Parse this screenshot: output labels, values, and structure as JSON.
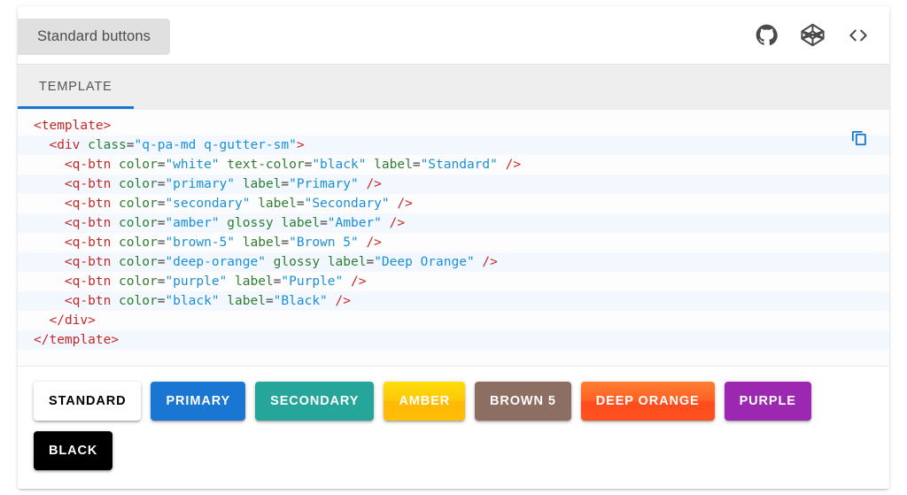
{
  "card": {
    "title_tag": "Standard buttons"
  },
  "header": {
    "icons": [
      {
        "name": "github-icon",
        "label": "GitHub"
      },
      {
        "name": "codepen-icon",
        "label": "Codepen"
      },
      {
        "name": "code-icon",
        "label": "Source code"
      }
    ],
    "icon_color": "#4a4a4a"
  },
  "tabs": [
    {
      "label": "TEMPLATE",
      "active": true
    }
  ],
  "code": {
    "language": "html",
    "copy_icon": "copy-icon",
    "copy_icon_color": "#1976d2",
    "colors": {
      "tag": "#c62828",
      "attribute": "#2e7d32",
      "value": "#1a8fd8",
      "background": "#fdfdfd",
      "stripe": "#f2f8fd"
    },
    "lines": [
      [
        {
          "t": "punc",
          "s": "<"
        },
        {
          "t": "tag",
          "s": "template"
        },
        {
          "t": "punc",
          "s": ">"
        }
      ],
      [
        {
          "t": "plain",
          "s": "  "
        },
        {
          "t": "punc",
          "s": "<"
        },
        {
          "t": "tag",
          "s": "div"
        },
        {
          "t": "plain",
          "s": " "
        },
        {
          "t": "attr",
          "s": "class"
        },
        {
          "t": "plain",
          "s": "="
        },
        {
          "t": "val",
          "s": "\"q-pa-md q-gutter-sm\""
        },
        {
          "t": "punc",
          "s": ">"
        }
      ],
      [
        {
          "t": "plain",
          "s": "    "
        },
        {
          "t": "punc",
          "s": "<"
        },
        {
          "t": "tag",
          "s": "q-btn"
        },
        {
          "t": "plain",
          "s": " "
        },
        {
          "t": "attr",
          "s": "color"
        },
        {
          "t": "plain",
          "s": "="
        },
        {
          "t": "val",
          "s": "\"white\""
        },
        {
          "t": "plain",
          "s": " "
        },
        {
          "t": "attr",
          "s": "text-color"
        },
        {
          "t": "plain",
          "s": "="
        },
        {
          "t": "val",
          "s": "\"black\""
        },
        {
          "t": "plain",
          "s": " "
        },
        {
          "t": "attr",
          "s": "label"
        },
        {
          "t": "plain",
          "s": "="
        },
        {
          "t": "val",
          "s": "\"Standard\""
        },
        {
          "t": "plain",
          "s": " "
        },
        {
          "t": "punc",
          "s": "/>"
        }
      ],
      [
        {
          "t": "plain",
          "s": "    "
        },
        {
          "t": "punc",
          "s": "<"
        },
        {
          "t": "tag",
          "s": "q-btn"
        },
        {
          "t": "plain",
          "s": " "
        },
        {
          "t": "attr",
          "s": "color"
        },
        {
          "t": "plain",
          "s": "="
        },
        {
          "t": "val",
          "s": "\"primary\""
        },
        {
          "t": "plain",
          "s": " "
        },
        {
          "t": "attr",
          "s": "label"
        },
        {
          "t": "plain",
          "s": "="
        },
        {
          "t": "val",
          "s": "\"Primary\""
        },
        {
          "t": "plain",
          "s": " "
        },
        {
          "t": "punc",
          "s": "/>"
        }
      ],
      [
        {
          "t": "plain",
          "s": "    "
        },
        {
          "t": "punc",
          "s": "<"
        },
        {
          "t": "tag",
          "s": "q-btn"
        },
        {
          "t": "plain",
          "s": " "
        },
        {
          "t": "attr",
          "s": "color"
        },
        {
          "t": "plain",
          "s": "="
        },
        {
          "t": "val",
          "s": "\"secondary\""
        },
        {
          "t": "plain",
          "s": " "
        },
        {
          "t": "attr",
          "s": "label"
        },
        {
          "t": "plain",
          "s": "="
        },
        {
          "t": "val",
          "s": "\"Secondary\""
        },
        {
          "t": "plain",
          "s": " "
        },
        {
          "t": "punc",
          "s": "/>"
        }
      ],
      [
        {
          "t": "plain",
          "s": "    "
        },
        {
          "t": "punc",
          "s": "<"
        },
        {
          "t": "tag",
          "s": "q-btn"
        },
        {
          "t": "plain",
          "s": " "
        },
        {
          "t": "attr",
          "s": "color"
        },
        {
          "t": "plain",
          "s": "="
        },
        {
          "t": "val",
          "s": "\"amber\""
        },
        {
          "t": "plain",
          "s": " "
        },
        {
          "t": "attr",
          "s": "glossy"
        },
        {
          "t": "plain",
          "s": " "
        },
        {
          "t": "attr",
          "s": "label"
        },
        {
          "t": "plain",
          "s": "="
        },
        {
          "t": "val",
          "s": "\"Amber\""
        },
        {
          "t": "plain",
          "s": " "
        },
        {
          "t": "punc",
          "s": "/>"
        }
      ],
      [
        {
          "t": "plain",
          "s": "    "
        },
        {
          "t": "punc",
          "s": "<"
        },
        {
          "t": "tag",
          "s": "q-btn"
        },
        {
          "t": "plain",
          "s": " "
        },
        {
          "t": "attr",
          "s": "color"
        },
        {
          "t": "plain",
          "s": "="
        },
        {
          "t": "val",
          "s": "\"brown-5\""
        },
        {
          "t": "plain",
          "s": " "
        },
        {
          "t": "attr",
          "s": "label"
        },
        {
          "t": "plain",
          "s": "="
        },
        {
          "t": "val",
          "s": "\"Brown 5\""
        },
        {
          "t": "plain",
          "s": " "
        },
        {
          "t": "punc",
          "s": "/>"
        }
      ],
      [
        {
          "t": "plain",
          "s": "    "
        },
        {
          "t": "punc",
          "s": "<"
        },
        {
          "t": "tag",
          "s": "q-btn"
        },
        {
          "t": "plain",
          "s": " "
        },
        {
          "t": "attr",
          "s": "color"
        },
        {
          "t": "plain",
          "s": "="
        },
        {
          "t": "val",
          "s": "\"deep-orange\""
        },
        {
          "t": "plain",
          "s": " "
        },
        {
          "t": "attr",
          "s": "glossy"
        },
        {
          "t": "plain",
          "s": " "
        },
        {
          "t": "attr",
          "s": "label"
        },
        {
          "t": "plain",
          "s": "="
        },
        {
          "t": "val",
          "s": "\"Deep Orange\""
        },
        {
          "t": "plain",
          "s": " "
        },
        {
          "t": "punc",
          "s": "/>"
        }
      ],
      [
        {
          "t": "plain",
          "s": "    "
        },
        {
          "t": "punc",
          "s": "<"
        },
        {
          "t": "tag",
          "s": "q-btn"
        },
        {
          "t": "plain",
          "s": " "
        },
        {
          "t": "attr",
          "s": "color"
        },
        {
          "t": "plain",
          "s": "="
        },
        {
          "t": "val",
          "s": "\"purple\""
        },
        {
          "t": "plain",
          "s": " "
        },
        {
          "t": "attr",
          "s": "label"
        },
        {
          "t": "plain",
          "s": "="
        },
        {
          "t": "val",
          "s": "\"Purple\""
        },
        {
          "t": "plain",
          "s": " "
        },
        {
          "t": "punc",
          "s": "/>"
        }
      ],
      [
        {
          "t": "plain",
          "s": "    "
        },
        {
          "t": "punc",
          "s": "<"
        },
        {
          "t": "tag",
          "s": "q-btn"
        },
        {
          "t": "plain",
          "s": " "
        },
        {
          "t": "attr",
          "s": "color"
        },
        {
          "t": "plain",
          "s": "="
        },
        {
          "t": "val",
          "s": "\"black\""
        },
        {
          "t": "plain",
          "s": " "
        },
        {
          "t": "attr",
          "s": "label"
        },
        {
          "t": "plain",
          "s": "="
        },
        {
          "t": "val",
          "s": "\"Black\""
        },
        {
          "t": "plain",
          "s": " "
        },
        {
          "t": "punc",
          "s": "/>"
        }
      ],
      [
        {
          "t": "plain",
          "s": "  "
        },
        {
          "t": "punc",
          "s": "</"
        },
        {
          "t": "tag",
          "s": "div"
        },
        {
          "t": "punc",
          "s": ">"
        }
      ],
      [
        {
          "t": "punc",
          "s": "</"
        },
        {
          "t": "tag",
          "s": "template"
        },
        {
          "t": "punc",
          "s": ">"
        }
      ]
    ]
  },
  "demo": {
    "buttons": [
      {
        "name": "standard-button",
        "label": "Standard",
        "bg": "#ffffff",
        "fg": "#000000",
        "glossy": false
      },
      {
        "name": "primary-button",
        "label": "Primary",
        "bg": "#1976d2",
        "fg": "#ffffff",
        "glossy": false
      },
      {
        "name": "secondary-button",
        "label": "Secondary",
        "bg": "#26a69a",
        "fg": "#ffffff",
        "glossy": false
      },
      {
        "name": "amber-button",
        "label": "Amber",
        "bg": "#ffc107",
        "fg": "#ffffff",
        "glossy": true
      },
      {
        "name": "brown-5-button",
        "label": "Brown 5",
        "bg": "#8d6e63",
        "fg": "#ffffff",
        "glossy": false
      },
      {
        "name": "deep-orange-button",
        "label": "Deep Orange",
        "bg": "#ff5722",
        "fg": "#ffffff",
        "glossy": true
      },
      {
        "name": "purple-button",
        "label": "Purple",
        "bg": "#9c27b0",
        "fg": "#ffffff",
        "glossy": false
      },
      {
        "name": "black-button",
        "label": "Black",
        "bg": "#000000",
        "fg": "#ffffff",
        "glossy": false
      }
    ]
  }
}
